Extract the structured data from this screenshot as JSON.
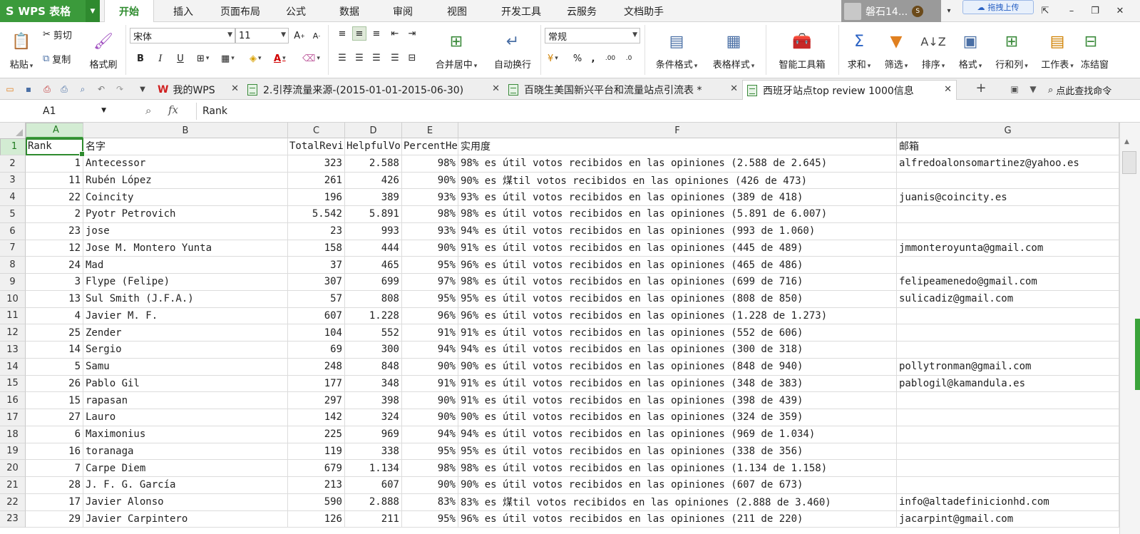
{
  "app": {
    "name": "WPS 表格",
    "logo": "S"
  },
  "menu_tabs": [
    "开始",
    "插入",
    "页面布局",
    "公式",
    "数据",
    "审阅",
    "视图",
    "开发工具",
    "云服务",
    "文档助手"
  ],
  "active_tab": "开始",
  "user": {
    "name": "磐石14...",
    "coin": "S"
  },
  "cloud_upload": "拖拽上传",
  "ribbon": {
    "paste": "粘贴",
    "cut": "剪切",
    "copy": "复制",
    "format_painter": "格式刷",
    "font_name": "宋体",
    "font_size": "11",
    "bold": "B",
    "italic": "I",
    "underline": "U",
    "merge_center": "合并居中",
    "wrap_text": "自动换行",
    "number_format": "常规",
    "percent": "%",
    "comma": ",",
    "cond_format": "条件格式",
    "table_style": "表格样式",
    "smart_toolbox": "智能工具箱",
    "sum": "求和",
    "filter": "筛选",
    "sort": "排序",
    "format": "格式",
    "row_col": "行和列",
    "worksheet": "工作表",
    "freeze": "冻结窗"
  },
  "doc_tabs": [
    {
      "label": "我的WPS"
    },
    {
      "label": "2.引荐流量来源-(2015-01-01-2015-06-30)"
    },
    {
      "label": "百晓生美国新兴平台和流量站点引流表 *"
    },
    {
      "label": "西班牙站点top review 1000信息"
    }
  ],
  "search_command": "点此查找命令",
  "formula_bar": {
    "name_box": "A1",
    "formula": "Rank"
  },
  "columns": [
    "A",
    "B",
    "C",
    "D",
    "E",
    "F",
    "G"
  ],
  "header_row": [
    "Rank",
    "名字",
    "TotalRevi",
    "HelpfulVo",
    "PercentHe",
    "实用度",
    "邮箱"
  ],
  "rows": [
    {
      "n": "2",
      "a": "1",
      "b": "Antecessor",
      "c": "323",
      "d": "2.588",
      "e": "98%",
      "f": "98% es útil votos recibidos en las opiniones (2.588 de 2.645)",
      "g": "alfredoalonsomartinez@yahoo.es"
    },
    {
      "n": "3",
      "a": "11",
      "b": "Rubén López",
      "c": "261",
      "d": "426",
      "e": "90%",
      "f": "90% es 煤til votos recibidos en las opiniones (426 de 473)",
      "g": ""
    },
    {
      "n": "4",
      "a": "22",
      "b": "Coincity",
      "c": "196",
      "d": "389",
      "e": "93%",
      "f": "93% es útil votos recibidos en las opiniones (389 de 418)",
      "g": "juanis@coincity.es"
    },
    {
      "n": "5",
      "a": "2",
      "b": "Pyotr Petrovich",
      "c": "5.542",
      "d": "5.891",
      "e": "98%",
      "f": "98% es útil votos recibidos en las opiniones (5.891 de 6.007)",
      "g": ""
    },
    {
      "n": "6",
      "a": "23",
      "b": "jose",
      "c": "23",
      "d": "993",
      "e": "93%",
      "f": "94% es útil votos recibidos en las opiniones (993 de 1.060)",
      "g": ""
    },
    {
      "n": "7",
      "a": "12",
      "b": "Jose M. Montero Yunta",
      "c": "158",
      "d": "444",
      "e": "90%",
      "f": "91% es útil votos recibidos en las opiniones (445 de 489)",
      "g": "jmmonteroyunta@gmail.com"
    },
    {
      "n": "8",
      "a": "24",
      "b": "Mad",
      "c": "37",
      "d": "465",
      "e": "95%",
      "f": "96% es útil votos recibidos en las opiniones (465 de 486)",
      "g": ""
    },
    {
      "n": "9",
      "a": "3",
      "b": "Flype (Felipe)",
      "c": "307",
      "d": "699",
      "e": "97%",
      "f": "98% es útil votos recibidos en las opiniones (699 de 716)",
      "g": "felipeamenedo@gmail.com"
    },
    {
      "n": "10",
      "a": "13",
      "b": "Sul Smith (J.F.A.)",
      "c": "57",
      "d": "808",
      "e": "95%",
      "f": "95% es útil votos recibidos en las opiniones (808 de 850)",
      "g": "sulicadiz@gmail.com"
    },
    {
      "n": "11",
      "a": "4",
      "b": "Javier M. F.",
      "c": "607",
      "d": "1.228",
      "e": "96%",
      "f": "96% es útil votos recibidos en las opiniones (1.228 de 1.273)",
      "g": ""
    },
    {
      "n": "12",
      "a": "25",
      "b": "Zender",
      "c": "104",
      "d": "552",
      "e": "91%",
      "f": "91% es útil votos recibidos en las opiniones (552 de 606)",
      "g": ""
    },
    {
      "n": "13",
      "a": "14",
      "b": "Sergio",
      "c": "69",
      "d": "300",
      "e": "94%",
      "f": "94% es útil votos recibidos en las opiniones (300 de 318)",
      "g": ""
    },
    {
      "n": "14",
      "a": "5",
      "b": "Samu",
      "c": "248",
      "d": "848",
      "e": "90%",
      "f": "90% es útil votos recibidos en las opiniones (848 de 940)",
      "g": "pollytronman@gmail.com"
    },
    {
      "n": "15",
      "a": "26",
      "b": "Pablo Gil",
      "c": "177",
      "d": "348",
      "e": "91%",
      "f": "91% es útil votos recibidos en las opiniones (348 de 383)",
      "g": "pablogil@kamandula.es"
    },
    {
      "n": "16",
      "a": "15",
      "b": "rapasan",
      "c": "297",
      "d": "398",
      "e": "90%",
      "f": "91% es útil votos recibidos en las opiniones (398 de 439)",
      "g": ""
    },
    {
      "n": "17",
      "a": "27",
      "b": "Lauro",
      "c": "142",
      "d": "324",
      "e": "90%",
      "f": "90% es útil votos recibidos en las opiniones (324 de 359)",
      "g": ""
    },
    {
      "n": "18",
      "a": "6",
      "b": "Maximonius",
      "c": "225",
      "d": "969",
      "e": "94%",
      "f": "94% es útil votos recibidos en las opiniones (969 de 1.034)",
      "g": ""
    },
    {
      "n": "19",
      "a": "16",
      "b": "toranaga",
      "c": "119",
      "d": "338",
      "e": "95%",
      "f": "95% es útil votos recibidos en las opiniones (338 de 356)",
      "g": ""
    },
    {
      "n": "20",
      "a": "7",
      "b": "Carpe Diem",
      "c": "679",
      "d": "1.134",
      "e": "98%",
      "f": "98% es útil votos recibidos en las opiniones (1.134 de 1.158)",
      "g": ""
    },
    {
      "n": "21",
      "a": "28",
      "b": "J. F. G. García",
      "c": "213",
      "d": "607",
      "e": "90%",
      "f": "90% es útil votos recibidos en las opiniones (607 de 673)",
      "g": ""
    },
    {
      "n": "22",
      "a": "17",
      "b": "Javier Alonso",
      "c": "590",
      "d": "2.888",
      "e": "83%",
      "f": "83% es 煤til votos recibidos en las opiniones (2.888 de 3.460)",
      "g": "info@altadefinicionhd.com"
    },
    {
      "n": "23",
      "a": "29",
      "b": "Javier Carpintero",
      "c": "126",
      "d": "211",
      "e": "95%",
      "f": "96% es útil votos recibidos en las opiniones (211 de 220)",
      "g": "jacarpint@gmail.com"
    }
  ],
  "colors": {
    "accent": "#3b9a3b",
    "active_tab_text": "#2b8a2b"
  }
}
